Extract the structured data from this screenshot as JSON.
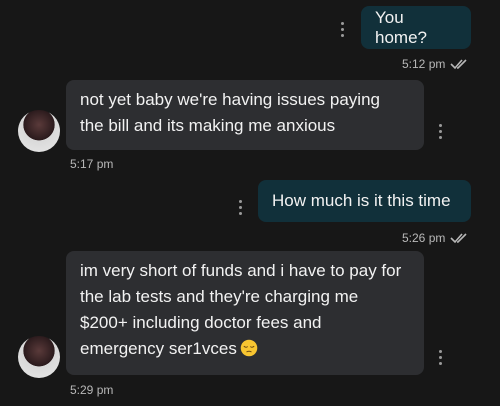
{
  "messages": [
    {
      "direction": "out",
      "text": "You home?",
      "time": "5:12 pm",
      "status": "read"
    },
    {
      "direction": "in",
      "lines": [
        "not yet baby we're having issues paying",
        "the bill and its making me anxious"
      ],
      "time": "5:17 pm"
    },
    {
      "direction": "out",
      "text": "How much is it this time",
      "time": "5:26 pm",
      "status": "read"
    },
    {
      "direction": "in",
      "lines": [
        "im very short of funds and i have to pay for",
        "the lab tests and they're charging me",
        "$200+ including doctor fees and",
        "emergency ser1vces"
      ],
      "emoji": "pensive-face-icon",
      "time": "5:29 pm"
    }
  ],
  "colors": {
    "background": "#171717",
    "outgoing_bubble": "#11303a",
    "incoming_bubble": "#2d2e31",
    "text": "#f2f2f2",
    "timestamp": "#b8b8b8",
    "read_ticks": "#b8b8b8"
  }
}
